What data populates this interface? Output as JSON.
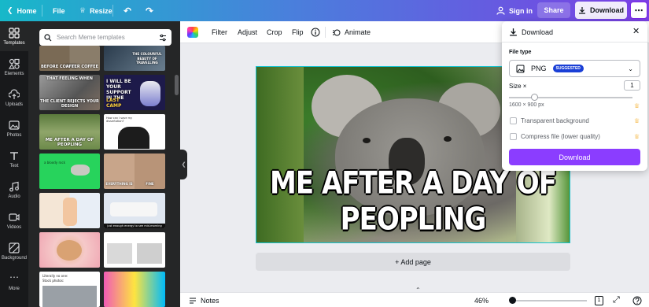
{
  "topbar": {
    "home": "Home",
    "file": "File",
    "resize": "Resize",
    "sign_in": "Sign in",
    "share": "Share",
    "download": "Download"
  },
  "rail": [
    {
      "label": "Templates",
      "icon": "templates-icon"
    },
    {
      "label": "Elements",
      "icon": "elements-icon"
    },
    {
      "label": "Uploads",
      "icon": "uploads-icon"
    },
    {
      "label": "Photos",
      "icon": "photos-icon"
    },
    {
      "label": "Text",
      "icon": "text-icon"
    },
    {
      "label": "Audio",
      "icon": "audio-icon"
    },
    {
      "label": "Videos",
      "icon": "videos-icon"
    },
    {
      "label": "Background",
      "icon": "background-icon"
    },
    {
      "label": "More",
      "icon": "more-icon"
    }
  ],
  "panel": {
    "search_placeholder": "Search Meme templates",
    "thumbs": [
      {
        "caption_a": "BEFORE COFFEE",
        "caption_b": "AFTER COFFEE"
      },
      {
        "caption_a": "THE COLOURFUL",
        "caption_b": "BEAUTY OF TRAVELLING"
      },
      {
        "caption_a": "THAT FEELING WHEN",
        "caption_b": "THE CLIENT REJECTS YOUR DESIGN"
      },
      {
        "caption_a": "I WILL BE YOUR SUPPORT IN THE",
        "caption_b": "LAST CAMP"
      },
      {
        "caption_a": "How can I save my dissertation?",
        "caption_b": ""
      },
      {
        "caption_a": "ME AFTER A DAY OF PEOPLING",
        "caption_b": ""
      },
      {
        "caption_a": "a bloody rock",
        "caption_b": ""
      },
      {
        "caption_a": "EVERYTHING IS",
        "caption_b": "FINE"
      },
      {
        "caption_a": "",
        "caption_b": ""
      },
      {
        "caption_a": "",
        "caption_b": "just enough energy to see mid-morning"
      },
      {
        "caption_a": "",
        "caption_b": ""
      },
      {
        "caption_a": "",
        "caption_b": ""
      },
      {
        "caption_a": "Literally no one:",
        "caption_b": "Stock photos:"
      },
      {
        "caption_a": "",
        "caption_b": ""
      }
    ]
  },
  "editor_toolbar": {
    "filter": "Filter",
    "adjust": "Adjust",
    "crop": "Crop",
    "flip": "Flip",
    "animate": "Animate"
  },
  "canvas": {
    "meme_caption": "ME AFTER A DAY OF PEOPLING",
    "add_page": "+ Add page"
  },
  "bottom": {
    "notes": "Notes",
    "zoom": "46%",
    "page_count": "1"
  },
  "download_panel": {
    "title": "Download",
    "file_type_label": "File type",
    "file_type_value": "PNG",
    "suggested_badge": "SUGGESTED",
    "size_label": "Size ×",
    "size_value": "1",
    "dimensions": "1600 × 900 px",
    "transparent_bg": "Transparent background",
    "compress": "Compress file (lower quality)",
    "download_button": "Download"
  },
  "colors": {
    "accent_purple": "#8b3dff",
    "badge_blue": "#1a3fd6",
    "selection_teal": "#14c2cf"
  }
}
